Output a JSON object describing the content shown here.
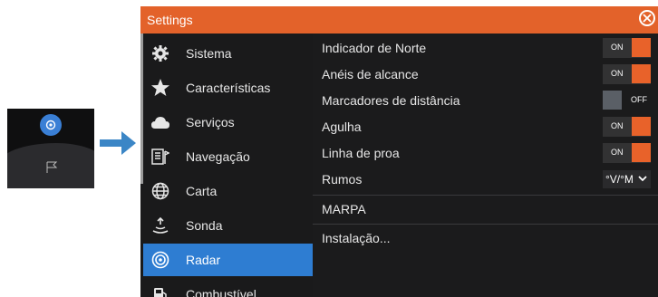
{
  "dialog": {
    "title": "Settings"
  },
  "sidebar": {
    "items": [
      {
        "label": "Sistema",
        "icon": "gear-icon"
      },
      {
        "label": "Características",
        "icon": "star-icon"
      },
      {
        "label": "Serviços",
        "icon": "cloud-icon"
      },
      {
        "label": "Navegação",
        "icon": "navigation-icon"
      },
      {
        "label": "Carta",
        "icon": "globe-icon"
      },
      {
        "label": "Sonda",
        "icon": "sonar-icon"
      },
      {
        "label": "Radar",
        "icon": "radar-icon",
        "active": true
      },
      {
        "label": "Combustível",
        "icon": "fuel-icon"
      }
    ]
  },
  "radar_settings": {
    "rows": [
      {
        "label": "Indicador de Norte",
        "control": "toggle",
        "state": "ON"
      },
      {
        "label": "Anéis de alcance",
        "control": "toggle",
        "state": "ON"
      },
      {
        "label": "Marcadores de distância",
        "control": "toggle",
        "state": "OFF"
      },
      {
        "label": "Agulha",
        "control": "toggle",
        "state": "ON"
      },
      {
        "label": "Linha de proa",
        "control": "toggle",
        "state": "ON"
      },
      {
        "label": "Rumos",
        "control": "select",
        "value": "°V/°M"
      },
      {
        "label": "MARPA",
        "control": "link"
      },
      {
        "label": "Instalação...",
        "control": "link"
      }
    ]
  },
  "colors": {
    "accent": "#e3622a",
    "selected": "#2e7dd2",
    "panel": "#1a1a1b"
  }
}
